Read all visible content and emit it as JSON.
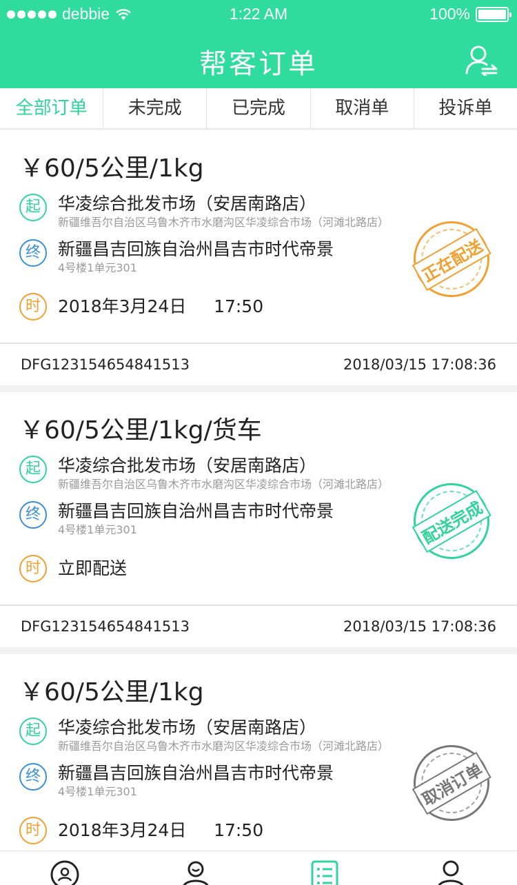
{
  "status_bar": {
    "carrier": "debbie",
    "time": "1:22 AM",
    "battery": "100%"
  },
  "header": {
    "title": "帮客订单"
  },
  "tabs": [
    {
      "label": "全部订单",
      "active": true
    },
    {
      "label": "未完成",
      "active": false
    },
    {
      "label": "已完成",
      "active": false
    },
    {
      "label": "取消单",
      "active": false
    },
    {
      "label": "投诉单",
      "active": false
    }
  ],
  "orders": [
    {
      "price": "￥60/5公里/1kg",
      "start_badge": "起",
      "start_name": "华凌综合批发市场（安居南路店）",
      "start_address": "新疆维吾尔自治区乌鲁木齐市水磨沟区华凌综合市场（河滩北路店）",
      "end_badge": "终",
      "end_name": "新疆昌吉回族自治州昌吉市时代帝景",
      "end_address": "4号楼1单元301",
      "time_badge": "时",
      "time": "2018年3月24日     17:50",
      "stamp": "正在配送",
      "order_no": "DFG123154654841513",
      "created_at": "2018/03/15 17:08:36"
    },
    {
      "price": "￥60/5公里/1kg/货车",
      "start_badge": "起",
      "start_name": "华凌综合批发市场（安居南路店）",
      "start_address": "新疆维吾尔自治区乌鲁木齐市水磨沟区华凌综合市场（河滩北路店）",
      "end_badge": "终",
      "end_name": "新疆昌吉回族自治州昌吉市时代帝景",
      "end_address": "4号楼1单元301",
      "time_badge": "时",
      "time": "立即配送",
      "stamp": "配送完成",
      "order_no": "DFG123154654841513",
      "created_at": "2018/03/15 17:08:36"
    },
    {
      "price": "￥60/5公里/1kg",
      "start_badge": "起",
      "start_name": "华凌综合批发市场（安居南路店）",
      "start_address": "新疆维吾尔自治区乌鲁木齐市水磨沟区华凌综合市场（河滩北路店）",
      "end_badge": "终",
      "end_name": "新疆昌吉回族自治州昌吉市时代帝景",
      "end_address": "4号楼1单元301",
      "time_badge": "时",
      "time": "2018年3月24日     17:50",
      "stamp": "取消订单"
    }
  ],
  "colors": {
    "brand": "#2fdc9d",
    "start": "#2fd49a",
    "end": "#3a8fd8",
    "time": "#f0a030"
  }
}
